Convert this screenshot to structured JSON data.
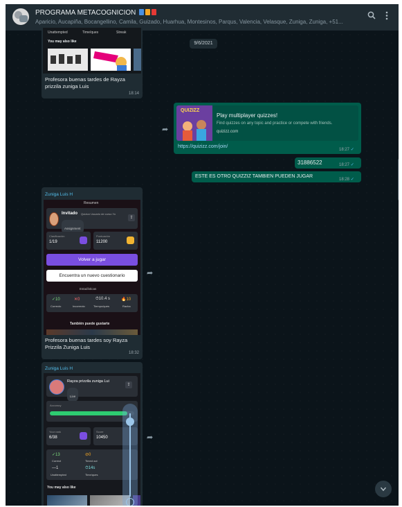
{
  "header": {
    "title": "PROGRAMA METACOGNICION",
    "flag_colors": [
      "#4a90e2",
      "#f5a623",
      "#e53935"
    ],
    "members": "Aparicio, Aucapiña, Bocangellino, Camila, Guizado, Huarhua, Montesinos, Parqus, Valencia, Velasque, Zuniga, Zuniga, +51..."
  },
  "date_pill": "9/6/2021",
  "messages": {
    "m1": {
      "preview_tabs": [
        "Unattempted",
        "Time/ques",
        "Streak"
      ],
      "preview_heading": "You may also like",
      "caption": "Profesora buenas tardes de Rayza prizzila zuniga Luis",
      "time": "18:14"
    },
    "m2": {
      "card_title": "Play multiplayer quizzes!",
      "card_desc": "Find quizzes on any topic and practice or compete with friends.",
      "card_domain": "quizizz.com",
      "logo_text": "QUIZIZZ",
      "link": "https://quizizz.com/join/",
      "time": "18:27"
    },
    "m3": {
      "text": "31886522",
      "time": "18:27"
    },
    "m4": {
      "text": "ESTE ES OTRO QUIZZIZ TAMBIEN PUEDEN JUGAR",
      "time": "18:28"
    },
    "m5": {
      "sender": "Zuniga Luis H",
      "shot_header": "Resumen",
      "invited_name": "Invitado",
      "invited_sub": "Quizizz Usuario de curso Yo",
      "assignment": "Assignment",
      "stat1_label": "Clasificación",
      "stat1_value": "1/19",
      "stat2_label": "Puntuación",
      "stat2_value": "11200",
      "play_again": "Volver a jugar",
      "find_quiz": "Encuentra un nuevo cuestionario",
      "stats_heading": "Estadísticas",
      "stats": [
        {
          "value": "✓10",
          "label": "Correcto"
        },
        {
          "value": "✕0",
          "label": "Incorrecto"
        },
        {
          "value": "⏱10.4 s",
          "label": "Tiempo/ques"
        },
        {
          "value": "🔥10",
          "label": "Racha"
        }
      ],
      "suggest": "También puede gustarte",
      "caption": "Profesora buenas tardes soy Rayza Prizzila Zuniga Luis",
      "time": "18:32"
    },
    "m6": {
      "sender": "Zuniga Luis H",
      "player": "Rayza prizzila zuniga Lui",
      "live": "Live",
      "accuracy_label": "Accuracy",
      "rank_label": "Your rank",
      "rank_value": "6/38",
      "score_label": "Score",
      "score_value": "10450",
      "stats": [
        {
          "value": "✓13",
          "label": "Correct"
        },
        {
          "value": "⊘0",
          "label": "Timed out"
        },
        {
          "value": "—1",
          "label": "Unattempted"
        },
        {
          "value": "⏱14s",
          "label": "Time/ques"
        }
      ],
      "also_like": "You may also like"
    }
  },
  "colors": {
    "app_bg": "#0b141a",
    "header_bg": "#202c33",
    "outgoing_bubble": "#005c4b",
    "incoming_bubble": "#1f2c33",
    "accent_purple": "#7a4ee0"
  },
  "icons": {
    "search": "search-icon",
    "menu": "kebab-menu-icon",
    "forward": "forward-icon",
    "scroll_down": "chevron-down-icon"
  }
}
